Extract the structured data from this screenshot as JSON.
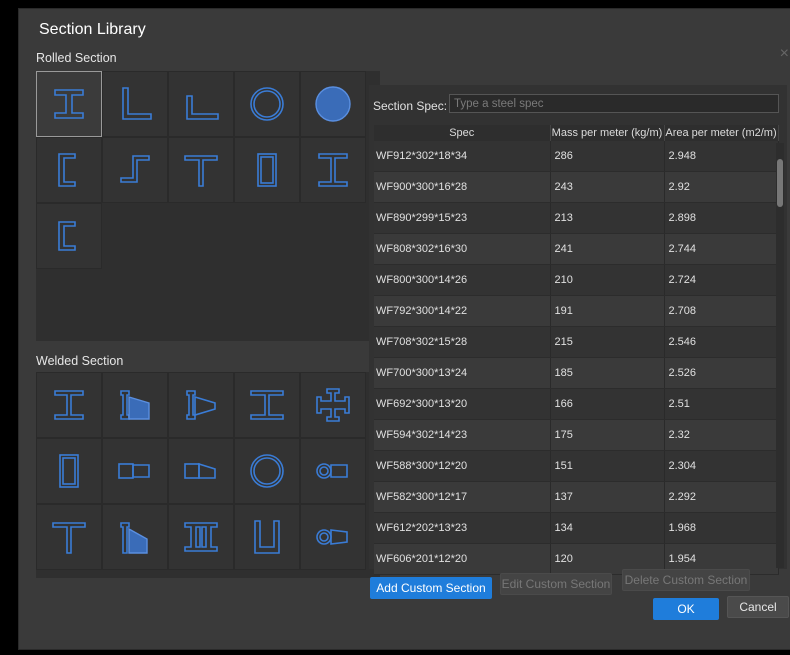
{
  "dialog": {
    "title": "Section Library",
    "close": "×"
  },
  "rolled": {
    "label": "Rolled Section"
  },
  "welded": {
    "label": "Welded Section"
  },
  "spec": {
    "label": "Section Spec:",
    "placeholder": "Type a steel spec"
  },
  "table": {
    "headers": [
      "Spec",
      "Mass per meter (kg/m)",
      "Area per meter (m2/m)"
    ],
    "rows": [
      [
        "WF912*302*18*34",
        "286",
        "2.948"
      ],
      [
        "WF900*300*16*28",
        "243",
        "2.92"
      ],
      [
        "WF890*299*15*23",
        "213",
        "2.898"
      ],
      [
        "WF808*302*16*30",
        "241",
        "2.744"
      ],
      [
        "WF800*300*14*26",
        "210",
        "2.724"
      ],
      [
        "WF792*300*14*22",
        "191",
        "2.708"
      ],
      [
        "WF708*302*15*28",
        "215",
        "2.546"
      ],
      [
        "WF700*300*13*24",
        "185",
        "2.526"
      ],
      [
        "WF692*300*13*20",
        "166",
        "2.51"
      ],
      [
        "WF594*302*14*23",
        "175",
        "2.32"
      ],
      [
        "WF588*300*12*20",
        "151",
        "2.304"
      ],
      [
        "WF582*300*12*17",
        "137",
        "2.292"
      ],
      [
        "WF612*202*13*23",
        "134",
        "1.968"
      ],
      [
        "WF606*201*12*20",
        "120",
        "1.954"
      ]
    ]
  },
  "buttons": {
    "add": "Add Custom Section",
    "edit": "Edit Custom Section",
    "delete": "Delete Custom Section",
    "ok": "OK",
    "cancel": "Cancel"
  },
  "colors": {
    "accent": "#1f7ddb",
    "shape": "#3a7cd6"
  }
}
